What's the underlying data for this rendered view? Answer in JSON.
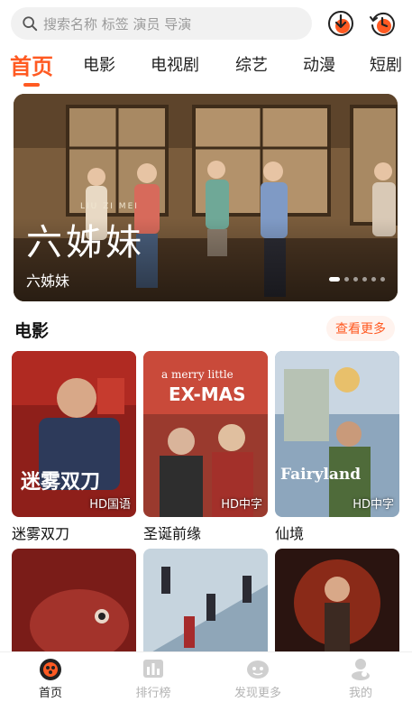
{
  "search": {
    "placeholder": "搜索名称 标签 演员 导演"
  },
  "top_icons": [
    "download-icon",
    "history-icon"
  ],
  "tabs": [
    {
      "label": "首页",
      "active": true
    },
    {
      "label": "电影"
    },
    {
      "label": "电视剧"
    },
    {
      "label": "综艺"
    },
    {
      "label": "动漫"
    },
    {
      "label": "短剧"
    }
  ],
  "banner": {
    "logo_text": "六姊妹",
    "logo_subtitle": "LIU ZI MEI",
    "title": "六姊妹",
    "slide_count": 6,
    "active_slide": 0
  },
  "section": {
    "title": "电影",
    "more_label": "查看更多"
  },
  "movies": [
    {
      "title": "迷雾双刀",
      "badge": "HD国语"
    },
    {
      "title": "圣诞前缘",
      "badge": "HD中字"
    },
    {
      "title": "仙境",
      "badge": "HD中字"
    }
  ],
  "poster_texts": {
    "m1": "迷雾双刀",
    "m2_line1": "a merry little",
    "m2_line2": "EX-MAS",
    "m3": "Fairyland"
  },
  "bottom_nav": [
    {
      "label": "首页",
      "icon": "home-icon",
      "active": true
    },
    {
      "label": "排行榜",
      "icon": "ranking-icon"
    },
    {
      "label": "发现更多",
      "icon": "discover-icon"
    },
    {
      "label": "我的",
      "icon": "profile-icon"
    }
  ],
  "colors": {
    "accent": "#ff5a22",
    "inactive": "#b3b3b3"
  }
}
